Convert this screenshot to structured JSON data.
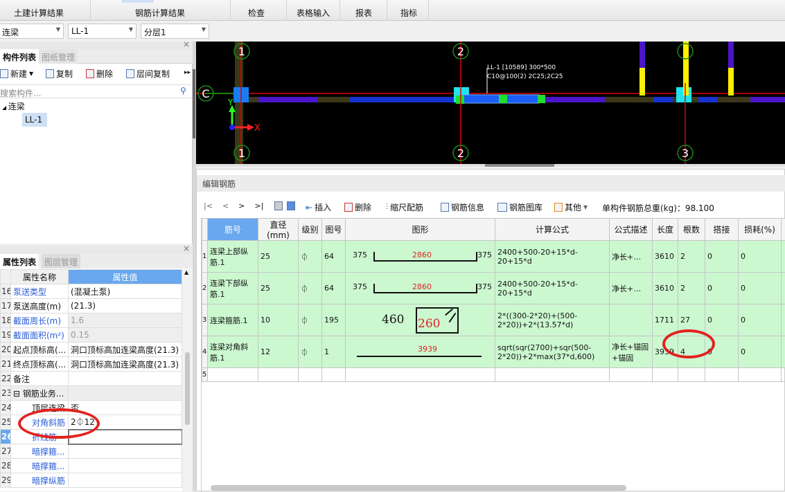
{
  "ribbon": {
    "tabs": [
      "土建计算结果",
      "钢筋计算结果",
      "检查",
      "表格输入",
      "报表",
      "指标"
    ]
  },
  "selectors": {
    "type": "连梁",
    "component": "LL-1",
    "layer": "分层1"
  },
  "component_panel": {
    "tabs": [
      "构件列表",
      "图纸管理"
    ],
    "toolbar": [
      "新建",
      "复制",
      "删除",
      "层间复制"
    ],
    "search_placeholder": "搜索构件...",
    "tree": {
      "group": "连梁",
      "item": "LL-1"
    }
  },
  "property_panel": {
    "tabs": [
      "属性列表",
      "图层管理"
    ],
    "headers": [
      "属性名称",
      "属性值"
    ],
    "rows": [
      {
        "n": "16",
        "name": "泵送类型",
        "value": "(混凝土泵)",
        "blue": true
      },
      {
        "n": "17",
        "name": "泵送高度(m)",
        "value": "(21.3)"
      },
      {
        "n": "18",
        "name": "截面周长(m)",
        "value": "1.6",
        "blue": true,
        "grey": true
      },
      {
        "n": "19",
        "name": "截面面积(m²)",
        "value": "0.15",
        "blue": true,
        "grey": true
      },
      {
        "n": "20",
        "name": "起点顶标高(...",
        "value": "洞口顶标高加连梁高度(21.3)"
      },
      {
        "n": "21",
        "name": "终点顶标高(...",
        "value": "洞口顶标高加连梁高度(21.3)"
      },
      {
        "n": "22",
        "name": "备注",
        "value": ""
      },
      {
        "n": "23",
        "name": "⊟ 钢筋业务...",
        "value": "",
        "grey": true
      },
      {
        "n": "24",
        "name": "顶层连梁",
        "value": "否",
        "indent": true
      },
      {
        "n": "25",
        "name": "对角斜筋",
        "value": "2⏀12",
        "blue": true,
        "indent": true
      },
      {
        "n": "26",
        "name": "折线筋",
        "value": "",
        "blue": true,
        "indent": true
      },
      {
        "n": "27",
        "name": "暗撑箍...",
        "value": "",
        "blue": true,
        "indent": true
      },
      {
        "n": "28",
        "name": "暗撑箍...",
        "value": "",
        "blue": true,
        "indent": true
      },
      {
        "n": "29",
        "name": "暗撑纵筋",
        "value": "",
        "blue": true,
        "indent": true
      }
    ]
  },
  "cad": {
    "axes": [
      "1",
      "2",
      "3"
    ],
    "row_axis": "C",
    "label_line1": "LL-1 [10589] 300*500",
    "label_line2": "C10@100(2) 2C25;2C25",
    "x_label": "X",
    "y_label": "Y"
  },
  "rebar_editor": {
    "title": "编辑钢筋",
    "toolbar": [
      "插入",
      "删除",
      "缩尺配筋",
      "钢筋信息",
      "钢筋图库",
      "其他"
    ],
    "total_weight_label": "单构件钢筋总重(kg)：98.100",
    "headers": [
      "筋号",
      "直径(mm)",
      "级别",
      "图号",
      "图形",
      "计算公式",
      "公式描述",
      "长度",
      "根数",
      "搭接",
      "损耗(%)"
    ],
    "rows": [
      {
        "n": "1",
        "name": "连梁上部纵筋.1",
        "dia": "25",
        "grade": "⏀",
        "fig": "64",
        "shape": {
          "left": "375",
          "mid": "2860",
          "right": "375"
        },
        "formula": "2400+500-20+15*d-20+15*d",
        "desc": "净长+…",
        "len": "3610",
        "count": "2",
        "lap": "0",
        "loss": "0"
      },
      {
        "n": "2",
        "name": "连梁下部纵筋.1",
        "dia": "25",
        "grade": "⏀",
        "fig": "64",
        "shape": {
          "left": "375",
          "mid": "2860",
          "right": "375"
        },
        "formula": "2400+500-20+15*d-20+15*d",
        "desc": "净长+…",
        "len": "3610",
        "count": "2",
        "lap": "0",
        "loss": "0"
      },
      {
        "n": "3",
        "name": "连梁箍筋.1",
        "dia": "10",
        "grade": "⏀",
        "fig": "195",
        "shape": {
          "left": "460",
          "mid": "260"
        },
        "formula": "2*((300-2*20)+(500-2*20))+2*(13.57*d)",
        "desc": "",
        "len": "1711",
        "count": "27",
        "lap": "0",
        "loss": "0"
      },
      {
        "n": "4",
        "name": "连梁对角斜筋.1",
        "dia": "12",
        "grade": "⏀",
        "fig": "1",
        "shape": {
          "mid": "3939"
        },
        "formula": "sqrt(sqr(2700)+sqr(500-2*20))+2*max(37*d,600)",
        "desc": "净长+锚固+锚固",
        "len": "3939",
        "count": "4",
        "lap": "0",
        "loss": "0"
      },
      {
        "n": "5",
        "name": "",
        "dia": "",
        "grade": "",
        "fig": "",
        "shape": {},
        "formula": "",
        "desc": "",
        "len": "",
        "count": "",
        "lap": "",
        "loss": ""
      }
    ]
  },
  "colors": {
    "highlight": "#e3211f",
    "row_green": "#ccf8d0",
    "header_blue": "#69a7ef"
  }
}
